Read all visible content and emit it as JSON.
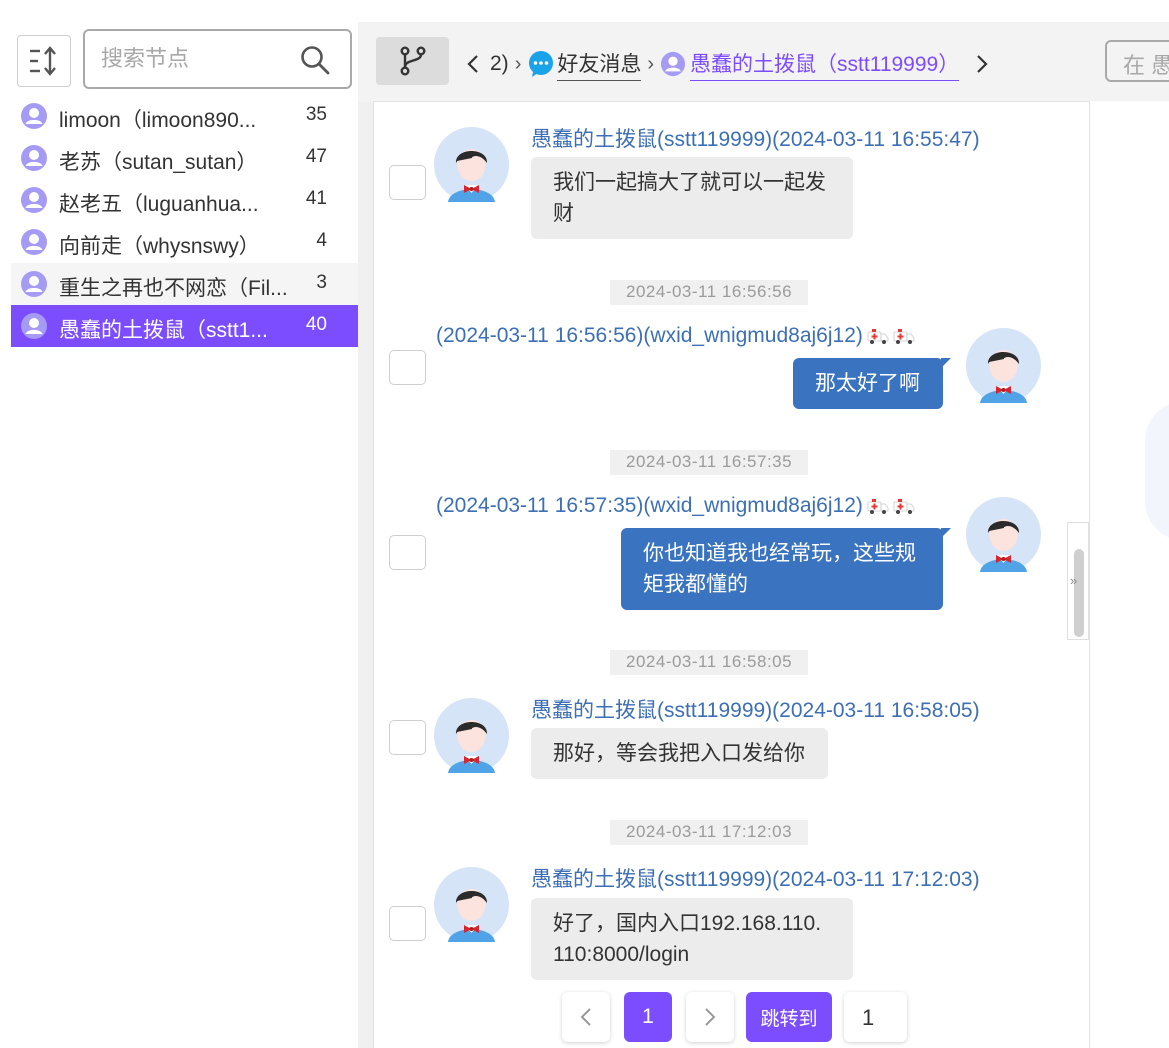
{
  "sidebar": {
    "search_placeholder": "搜索节点",
    "nodes": [
      {
        "label": "limoon（limoon890...",
        "count": "35"
      },
      {
        "label": "老苏（sutan_sutan）",
        "count": "47"
      },
      {
        "label": "赵老五（luguanhua...",
        "count": "41"
      },
      {
        "label": "向前走（whysnswy）",
        "count": "4"
      },
      {
        "label": "重生之再也不网恋（Fil...",
        "count": "3"
      },
      {
        "label": "愚蠢的土拨鼠（sstt1...",
        "count": "40"
      }
    ]
  },
  "header": {
    "crumb_prev_tail": "2)",
    "crumb_group": "好友消息",
    "crumb_contact": "愚蠢的土拨鼠（sstt119999）",
    "in_box_text": "在 愚"
  },
  "messages": [
    {
      "meta": "愚蠢的土拨鼠(sstt119999)(2024-03-11 16:55:47)",
      "line1": "我们一起搞大了就可以一起发",
      "line2": "财"
    },
    {
      "time": "2024-03-11 16:56:56",
      "meta": "(2024-03-11 16:56:56)(wxid_wnigmud8aj6j12)",
      "line1": "那太好了啊"
    },
    {
      "time": "2024-03-11 16:57:35",
      "meta": "(2024-03-11 16:57:35)(wxid_wnigmud8aj6j12)",
      "line1": "你也知道我也经常玩，这些规",
      "line2": "矩我都懂的"
    },
    {
      "time": "2024-03-11 16:58:05",
      "meta": "愚蠢的土拨鼠(sstt119999)(2024-03-11 16:58:05)",
      "line1": "那好，等会我把入口发给你"
    },
    {
      "time": "2024-03-11 17:12:03",
      "meta": "愚蠢的土拨鼠(sstt119999)(2024-03-11 17:12:03)",
      "line1": "好了，国内入口192.168.110.",
      "line2": "110:8000/login"
    }
  ],
  "pagination": {
    "current_page": "1",
    "jump_label": "跳转到",
    "jump_value": "1"
  },
  "colors": {
    "accent": "#7c4dff",
    "sent_bubble": "#3a73bf",
    "received_bubble": "#ececec",
    "meta_text": "#3c6fb5"
  },
  "icons": [
    "sort-icon",
    "search-icon",
    "user-icon",
    "branch-icon",
    "chevron-left-icon",
    "chevron-right-icon",
    "chat-bubble-icon",
    "ambulance-icon",
    "expand-icon"
  ]
}
